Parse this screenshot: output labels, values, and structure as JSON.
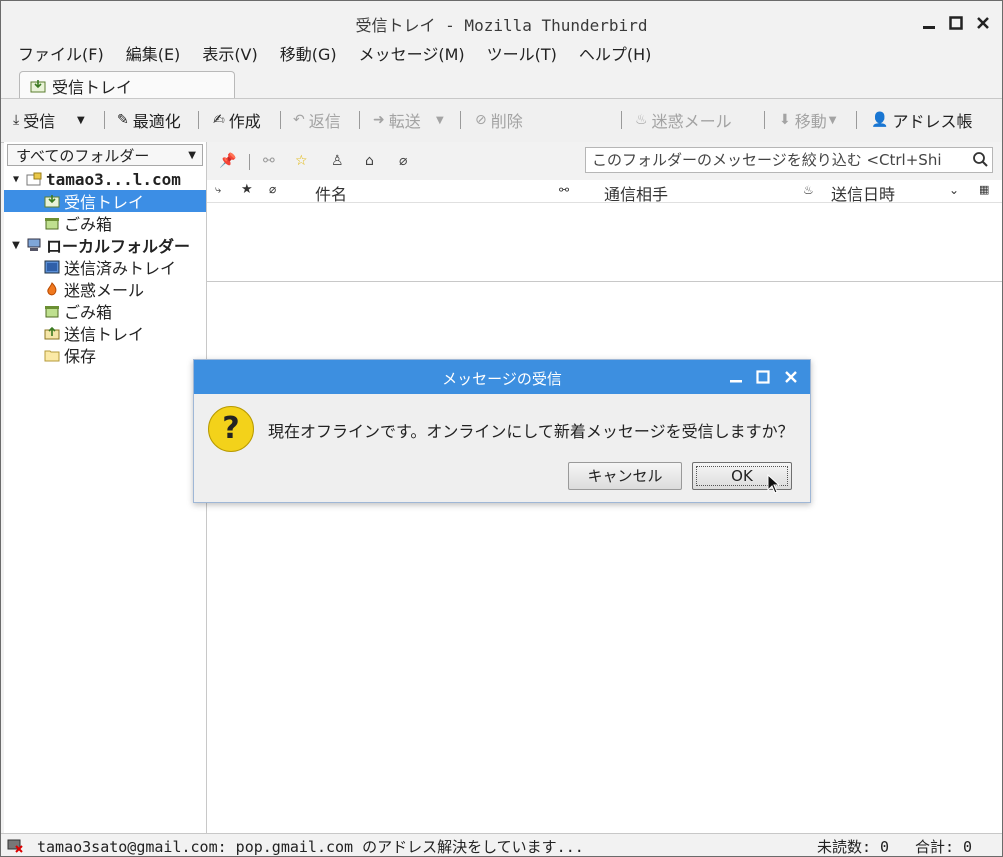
{
  "window": {
    "title": "受信トレイ - Mozilla Thunderbird"
  },
  "menu": [
    "ファイル(F)",
    "編集(E)",
    "表示(V)",
    "移動(G)",
    "メッセージ(M)",
    "ツール(T)",
    "ヘルプ(H)"
  ],
  "tab": {
    "label": "受信トレイ"
  },
  "toolbar": {
    "get_mail": "受信",
    "compact": "最適化",
    "write": "作成",
    "reply": "返信",
    "forward": "転送",
    "delete": "削除",
    "junk": "迷惑メール",
    "move": "移動",
    "address_book": "アドレス帳"
  },
  "folder_pane": {
    "selector": "すべてのフォルダー",
    "account": "tamao3...l.com",
    "account_folders": [
      "受信トレイ",
      "ごみ箱"
    ],
    "local": "ローカルフォルダー",
    "local_folders": [
      "送信済みトレイ",
      "迷惑メール",
      "ごみ箱",
      "送信トレイ",
      "保存"
    ]
  },
  "quick_filter": {
    "placeholder": "このフォルダーのメッセージを絞り込む <Ctrl+Shi"
  },
  "columns": {
    "subject": "件名",
    "correspondent": "通信相手",
    "date": "送信日時"
  },
  "status": {
    "message": "tamao3sato@gmail.com: pop.gmail.com のアドレス解決をしています...",
    "unread": "未読数: 0",
    "total": "合計: 0"
  },
  "dialog": {
    "title": "メッセージの受信",
    "message": "現在オフラインです。オンラインにして新着メッセージを受信しますか？",
    "cancel": "キャンセル",
    "ok": "OK"
  },
  "colors": {
    "accent": "#3c8ee5",
    "dialog_title": "#3d8fe0",
    "question_icon": "#f3d21a"
  }
}
